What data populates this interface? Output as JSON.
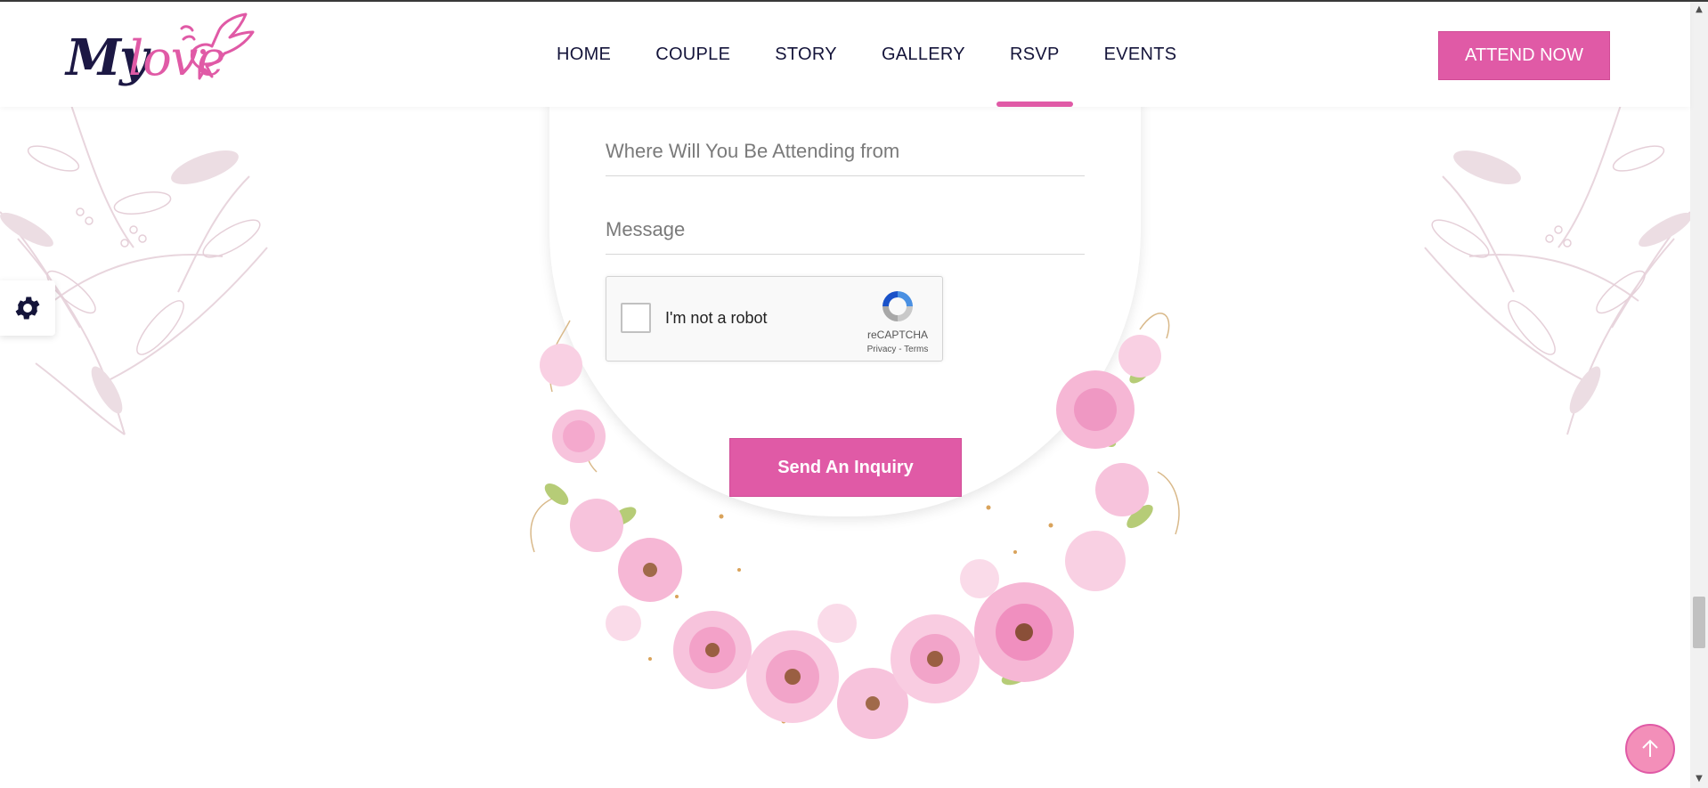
{
  "brand": {
    "logo_part1": "My",
    "logo_part2": "love"
  },
  "nav": {
    "items": [
      {
        "label": "HOME"
      },
      {
        "label": "COUPLE"
      },
      {
        "label": "STORY"
      },
      {
        "label": "GALLERY"
      },
      {
        "label": "RSVP",
        "active": true
      },
      {
        "label": "EVENTS"
      }
    ],
    "cta_label": "ATTEND NOW"
  },
  "form": {
    "attending_from_placeholder": "Where Will You Be Attending from",
    "message_placeholder": "Message",
    "recaptcha": {
      "label": "I'm not a robot",
      "brand": "reCAPTCHA",
      "links": "Privacy - Terms"
    },
    "submit_label": "Send An Inquiry"
  },
  "colors": {
    "accent": "#e05aa6",
    "navy": "#14143a",
    "leaf": "#e9d6df"
  },
  "icons": {
    "settings": "gear-icon",
    "back_to_top": "arrow-up-icon"
  }
}
